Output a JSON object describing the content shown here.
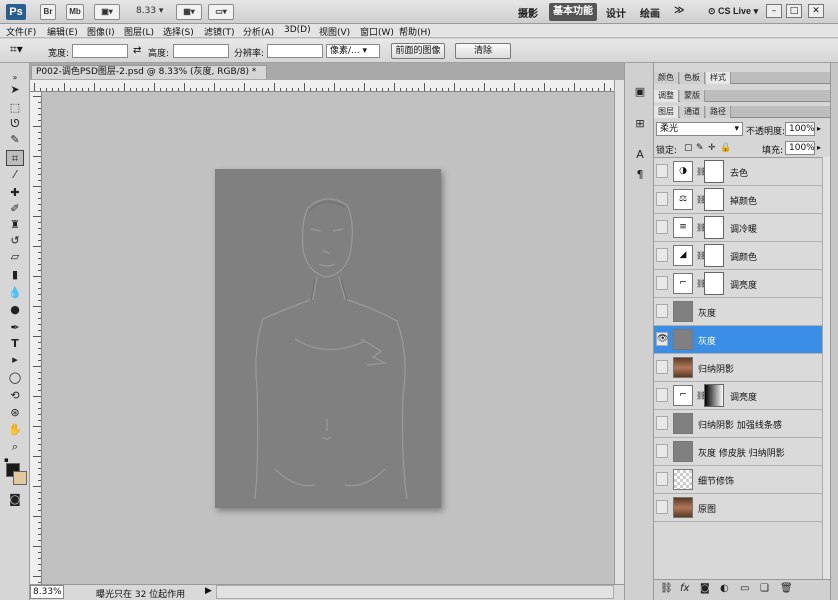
{
  "app": {
    "logo": "Ps",
    "br": "Br",
    "mb": "Mb",
    "zoom_value": "8.33",
    "workspaces": [
      "摄影",
      "基本功能",
      "设计",
      "绘画"
    ],
    "active_workspace": "基本功能",
    "more": "≫",
    "cslive": "CS Live",
    "window_controls": [
      "–",
      "□",
      "✕"
    ]
  },
  "menu": [
    "文件(F)",
    "编辑(E)",
    "图像(I)",
    "图层(L)",
    "选择(S)",
    "滤镜(T)",
    "分析(A)",
    "3D(D)",
    "视图(V)",
    "窗口(W)",
    "帮助(H)"
  ],
  "options": {
    "width_label": "宽度:",
    "height_label": "高度:",
    "swap_icon": "⇄",
    "resolution_label": "分辨率:",
    "unit_value": "像素/...",
    "front_image_button": "前面的图像",
    "clear_button": "清除"
  },
  "document": {
    "tab_title": "P002-调色PSD图层-2.psd @ 8.33% (灰度, RGB/8) *",
    "tab_close": "✕",
    "zoom": "8.33%",
    "status": "曝光只在 32 位起作用"
  },
  "panels": {
    "top_tabs": [
      "颜色",
      "色板",
      "样式"
    ],
    "top_active": "样式",
    "mid_tabs": [
      "调整",
      "蒙版"
    ],
    "layer_tabs": [
      "图层",
      "通道",
      "路径"
    ],
    "layer_tab_active": "图层",
    "blend_mode": "柔光",
    "opacity_label": "不透明度:",
    "opacity_value": "100%",
    "lock_label": "锁定:",
    "fill_label": "填充:",
    "fill_value": "100%"
  },
  "layers": [
    {
      "name": "去色",
      "kind": "adjustment",
      "icon": "◑",
      "mask": "white"
    },
    {
      "name": "掉颜色",
      "kind": "adjustment",
      "icon": "⚖",
      "mask": "white"
    },
    {
      "name": "调冷暖",
      "kind": "adjustment",
      "icon": "≡",
      "mask": "white"
    },
    {
      "name": "调颜色",
      "kind": "adjustment",
      "icon": "◢",
      "mask": "white"
    },
    {
      "name": "调亮度",
      "kind": "adjustment",
      "icon": "⌐",
      "mask": "white"
    },
    {
      "name": "灰度",
      "kind": "pixel",
      "icon": "",
      "mask": ""
    },
    {
      "name": "灰度",
      "kind": "pixel",
      "icon": "",
      "mask": "",
      "selected": true,
      "visible": true
    },
    {
      "name": "归纳阴影",
      "kind": "photo",
      "icon": "",
      "mask": ""
    },
    {
      "name": "调亮度",
      "kind": "adjustment",
      "icon": "⌐",
      "mask": "gradient"
    },
    {
      "name": "归纳阴影 加强线条感",
      "kind": "pixel",
      "icon": "",
      "mask": ""
    },
    {
      "name": "灰度 修皮肤 归纳阴影",
      "kind": "pixel",
      "icon": "",
      "mask": ""
    },
    {
      "name": "细节修饰",
      "kind": "checker",
      "icon": "",
      "mask": ""
    },
    {
      "name": "原图",
      "kind": "photo",
      "icon": "",
      "mask": ""
    }
  ],
  "colors": {
    "selected_layer": "#3a8ee6",
    "foreground": "#1a1a1a",
    "background": "#e2c89a"
  }
}
